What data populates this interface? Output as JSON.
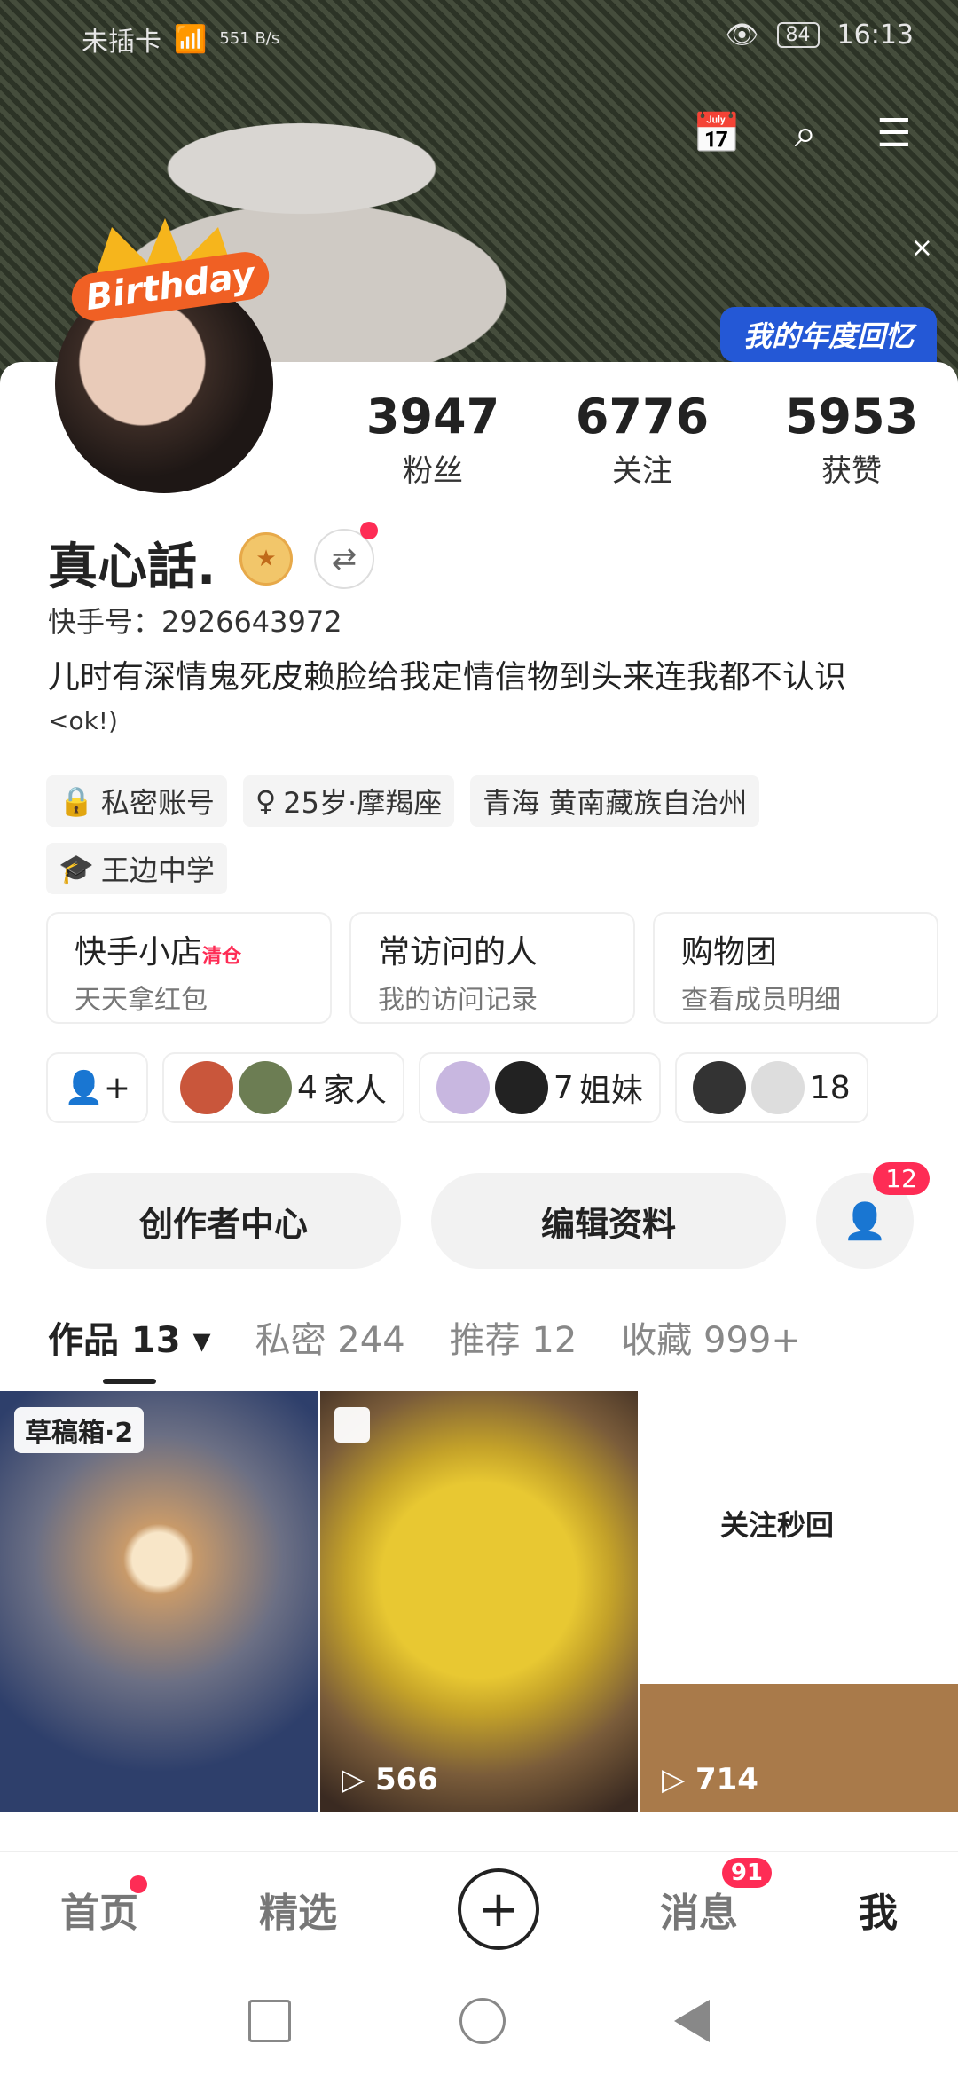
{
  "status": {
    "carrier": "未插卡",
    "speed": "551\nB/s",
    "battery": "84",
    "time": "16:13"
  },
  "header": {
    "recap": "我的年度回忆",
    "close": "×"
  },
  "profile": {
    "birthday": "Birthday",
    "stats": [
      {
        "num": "3947",
        "label": "粉丝"
      },
      {
        "num": "6776",
        "label": "关注"
      },
      {
        "num": "5953",
        "label": "获赞"
      }
    ],
    "name": "真心話.",
    "kid": "快手号：2926643972",
    "bio": "儿时有深情鬼死皮赖脸给我定情信物到头来连我都不认识",
    "bio2": "<ok!)",
    "tags": [
      "私密账号",
      "25岁·摩羯座",
      "青海 黄南藏族自治州",
      "王边中学"
    ]
  },
  "cards": [
    {
      "title": "快手小店",
      "hot": "清仓",
      "sub": "天天拿红包"
    },
    {
      "title": "常访问的人",
      "sub": "我的访问记录"
    },
    {
      "title": "购物团",
      "sub": "查看成员明细"
    }
  ],
  "groups": [
    {
      "count": "4",
      "label": "家人"
    },
    {
      "count": "7",
      "label": "姐妹"
    },
    {
      "count": "18",
      "label": ""
    }
  ],
  "actions": {
    "creator": "创作者中心",
    "edit": "编辑资料",
    "follow_badge": "12"
  },
  "tabs": [
    "作品 13 ▾",
    "私密 244",
    "推荐 12",
    "收藏 999+"
  ],
  "grid": [
    {
      "badge": "草稿箱·2"
    },
    {
      "plays": "566"
    },
    {
      "plays": "714",
      "mini_headline": "关注秒回"
    }
  ],
  "nav": {
    "home": "首页",
    "featured": "精选",
    "messages": "消息",
    "messages_badge": "91",
    "me": "我"
  }
}
